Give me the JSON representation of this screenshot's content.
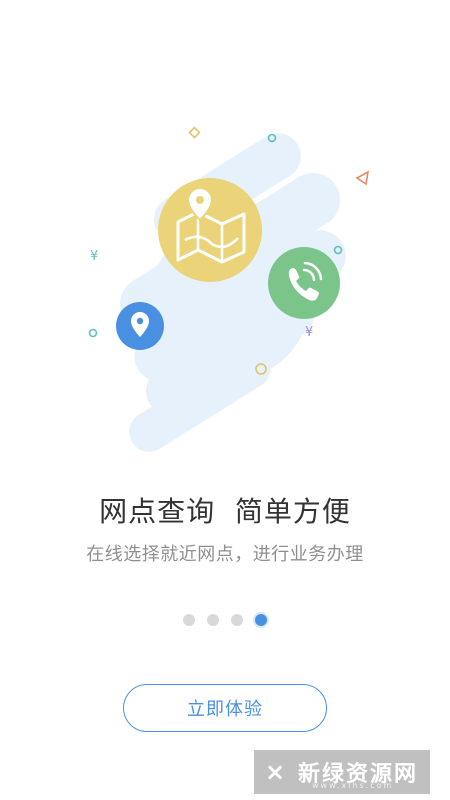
{
  "onboarding": {
    "title": "网点查询  简单方便",
    "subtitle": "在线选择就近网点，进行业务办理",
    "page_indicator": {
      "total": 4,
      "current": 4
    },
    "cta_label": "立即体验",
    "icons": [
      "map-icon",
      "phone-icon",
      "location-pin-icon"
    ],
    "colors": {
      "accent": "#4a90e2",
      "map_circle": "#ebd37a",
      "phone_circle": "#7cc58a",
      "pin_circle": "#4a90e2",
      "cloud": "#e6f1fb",
      "dot_inactive": "#d9d9d9"
    }
  },
  "watermark": {
    "text": "新绿资源网",
    "domain": "www.xlhs.com"
  }
}
